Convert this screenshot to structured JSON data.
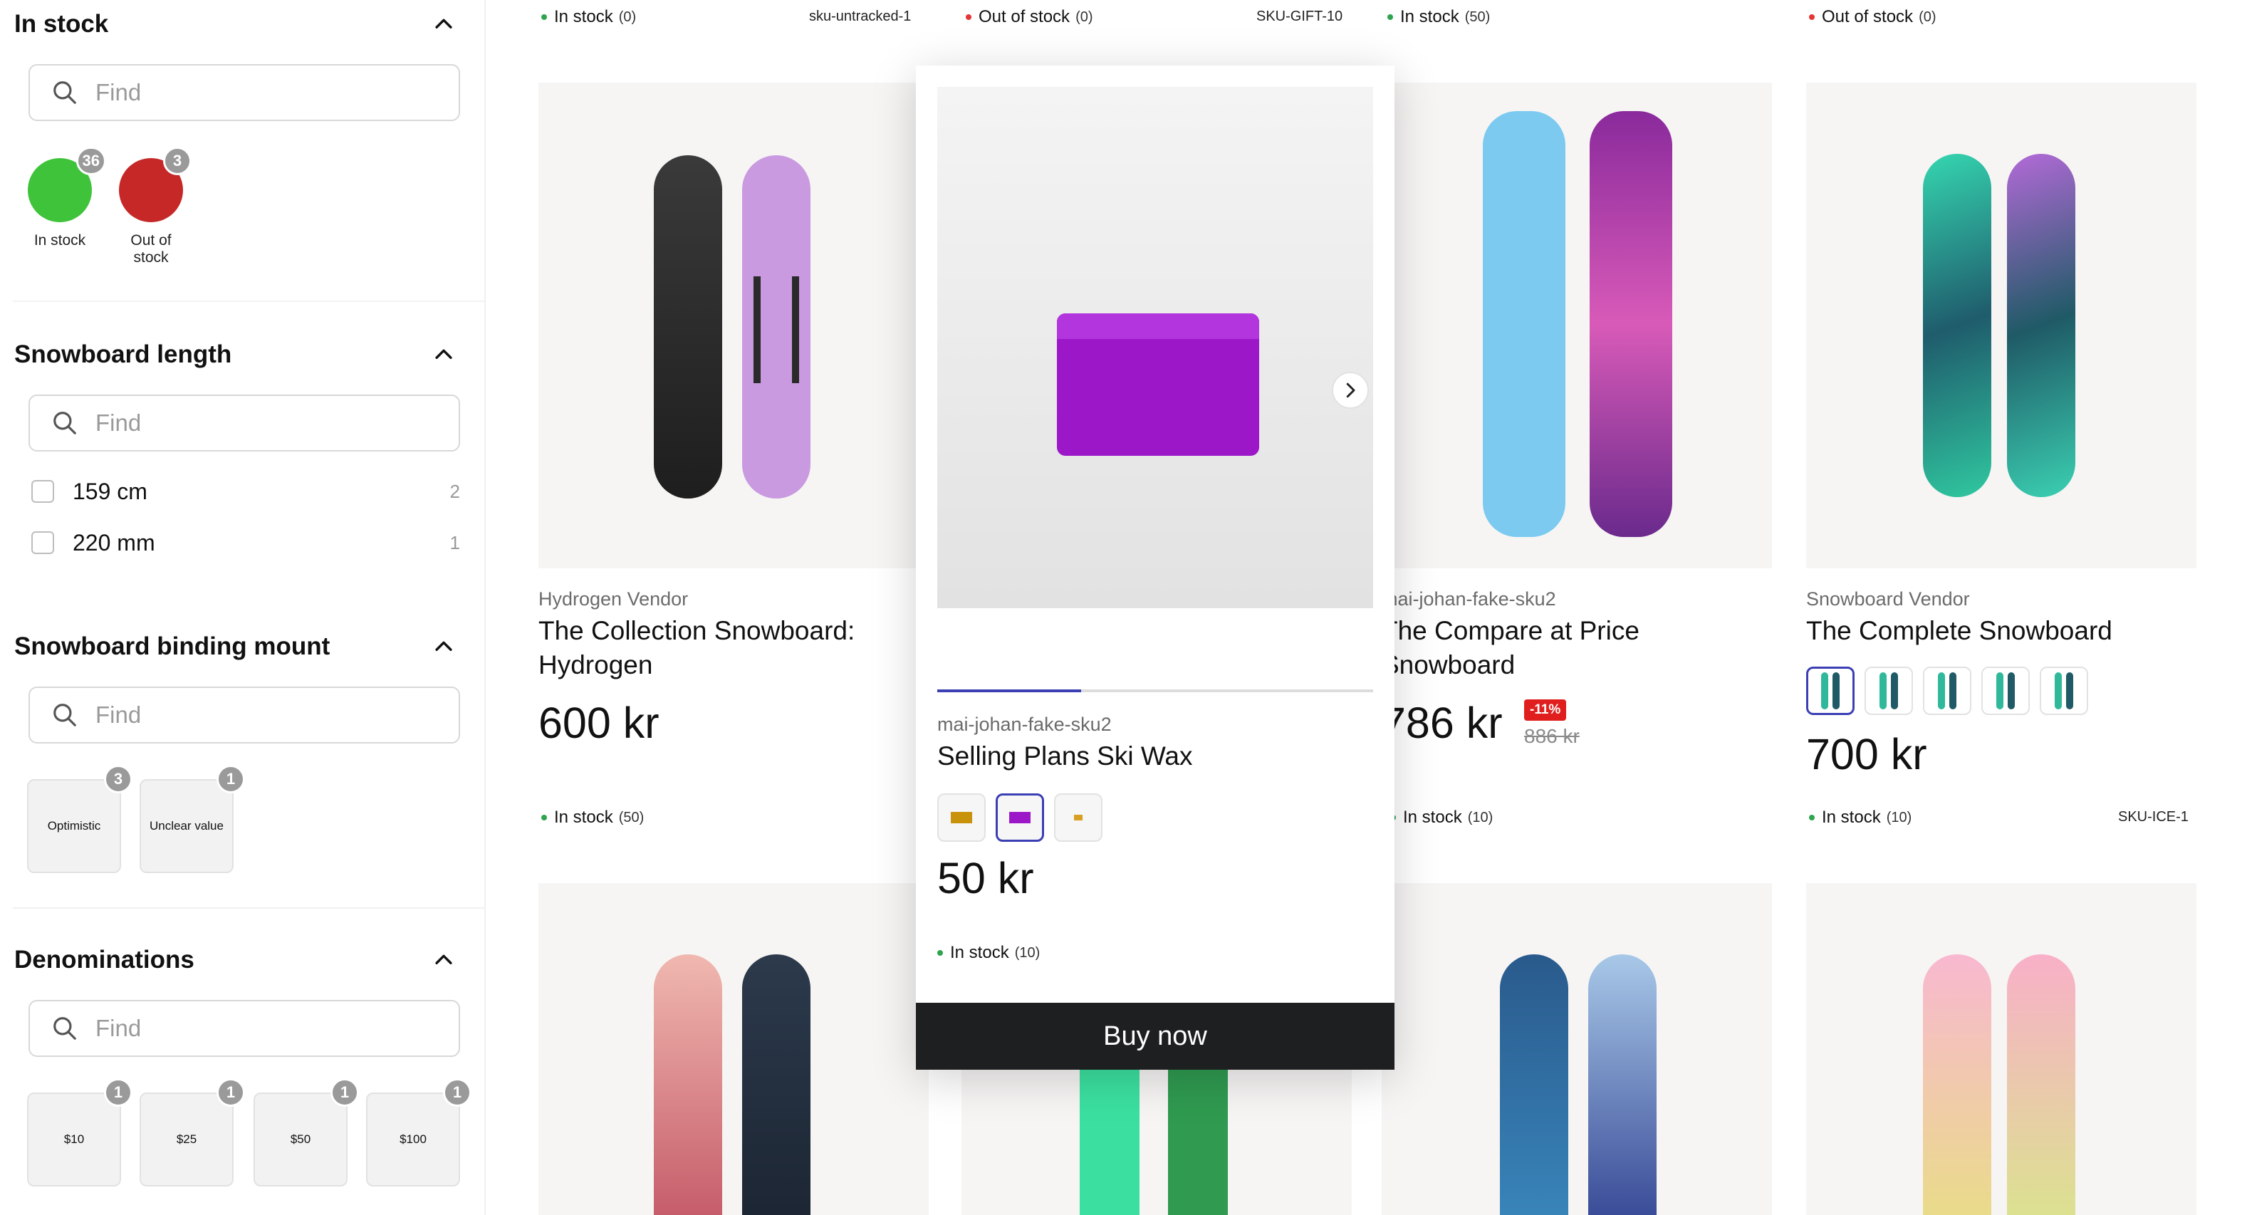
{
  "sidebar": {
    "in_stock": {
      "title": "In stock",
      "find_placeholder": "Find",
      "swatches": [
        {
          "label": "In stock",
          "count": "36",
          "color": "#3ec33a"
        },
        {
          "label": "Out of stock",
          "count": "3",
          "color": "#c62828"
        }
      ]
    },
    "length": {
      "title": "Snowboard length",
      "find_placeholder": "Find",
      "options": [
        {
          "label": "159 cm",
          "count": "2"
        },
        {
          "label": "220 mm",
          "count": "1"
        }
      ]
    },
    "binding": {
      "title": "Snowboard binding mount",
      "find_placeholder": "Find",
      "tiles": [
        {
          "label": "Optimistic",
          "count": "3"
        },
        {
          "label": "Unclear value",
          "count": "1"
        }
      ]
    },
    "denominations": {
      "title": "Denominations",
      "find_placeholder": "Find",
      "tiles": [
        {
          "label": "$10",
          "count": "1"
        },
        {
          "label": "$25",
          "count": "1"
        },
        {
          "label": "$50",
          "count": "1"
        },
        {
          "label": "$100",
          "count": "1"
        }
      ]
    }
  },
  "top_row": [
    {
      "stock": "In stock",
      "qty": "(0)",
      "sku": "sku-untracked-1"
    },
    {
      "stock": "Out of stock",
      "qty": "(0)",
      "sku": "SKU-GIFT-10"
    },
    {
      "stock": "In stock",
      "qty": "(50)",
      "sku": ""
    },
    {
      "stock": "Out of stock",
      "qty": "(0)",
      "sku": ""
    }
  ],
  "products": [
    {
      "vendor": "Hydrogen Vendor",
      "title_line1": "The Collection Snowboard:",
      "title_line2": "Hydrogen",
      "price": "600 kr",
      "stock": "In stock",
      "qty": "(50)",
      "sku": ""
    },
    {
      "vendor": "mai-johan-fake-sku2",
      "title_line1": "The Compare at Price",
      "title_line2": "Snowboard",
      "price": "786 kr",
      "compare_price": "886 kr",
      "sale_badge": "-11%",
      "stock": "In stock",
      "qty": "(10)",
      "sku": ""
    },
    {
      "vendor": "Snowboard Vendor",
      "title_line1": "The Complete Snowboard",
      "title_line2": "",
      "price": "700 kr",
      "stock": "In stock",
      "qty": "(10)",
      "sku": "SKU-ICE-1"
    }
  ],
  "popup": {
    "vendor": "mai-johan-fake-sku2",
    "title": "Selling Plans Ski Wax",
    "price": "50 kr",
    "stock": "In stock",
    "qty": "(10)",
    "buy_label": "Buy now",
    "next_icon": "chevron-right-icon",
    "image_progress": 0.33,
    "selected_variant": 2
  },
  "colors": {
    "accent": "#3b3fb3",
    "in_stock_dot": "#2ea44f",
    "out_of_stock_dot": "#e53535",
    "sale": "#e01e1e",
    "buy_button": "#1e1f20"
  }
}
